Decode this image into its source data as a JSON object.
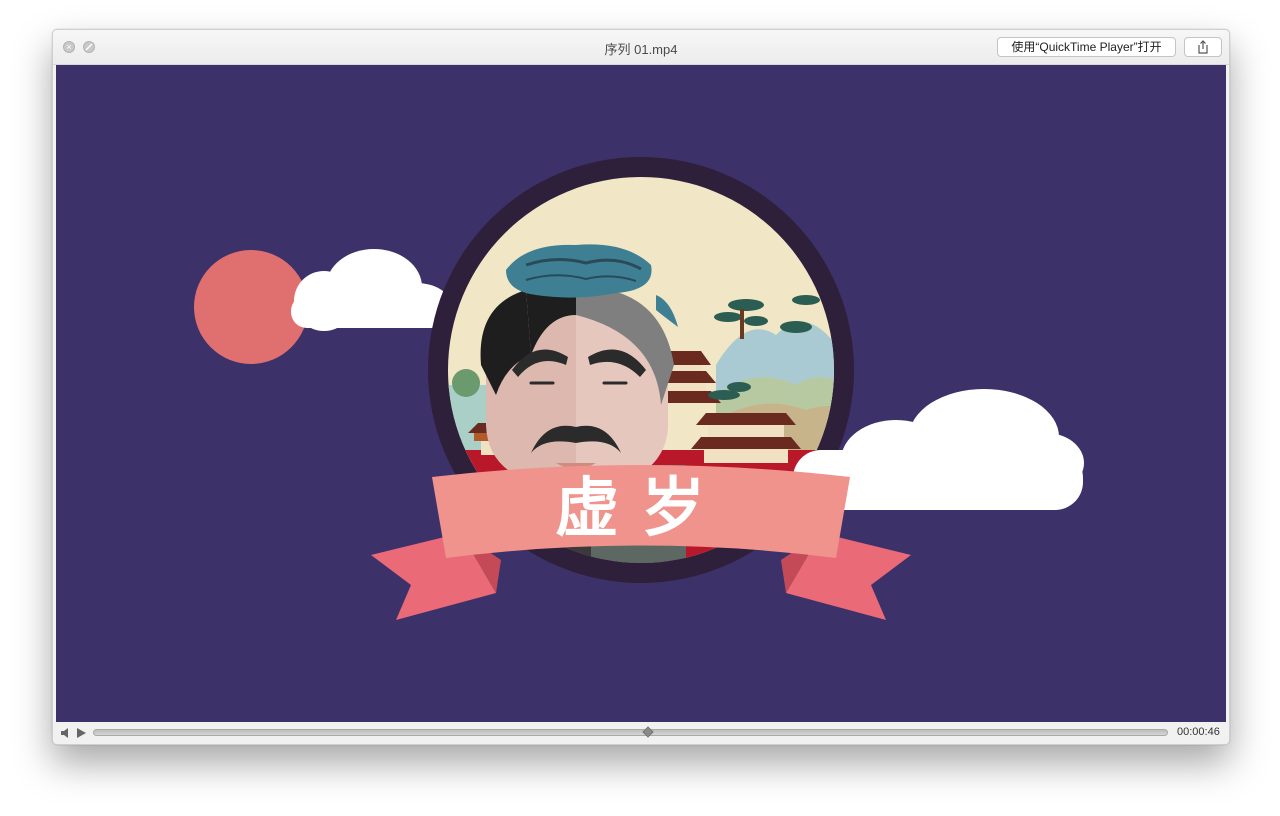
{
  "window": {
    "title": "序列 01.mp4",
    "open_with_label": "使用“QuickTime Player”打开"
  },
  "video": {
    "banner_text": "虚岁"
  },
  "controls": {
    "elapsed_time": "00:00:46",
    "playhead_position": 0.5
  },
  "icons": {
    "close": "close-icon",
    "minimize": "minimize-icon",
    "share": "share-icon",
    "volume": "volume-icon",
    "play": "play-icon"
  },
  "colors": {
    "video_background": "#3d316a",
    "sun": "#e07070",
    "ribbon": "#f0938c",
    "ribbon_tail": "#ea6a78"
  }
}
